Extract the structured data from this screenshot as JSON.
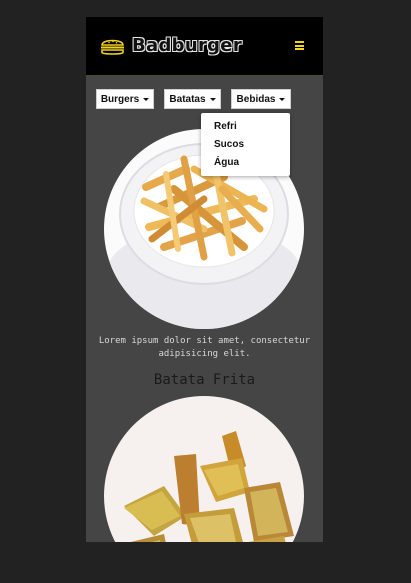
{
  "app": {
    "brand": "Badburger",
    "icons": {
      "logo": "burger-icon",
      "menu": "hamburger-menu-icon"
    },
    "accent_color": "#f2d21a"
  },
  "nav": {
    "dropdowns": [
      {
        "label": "Burgers"
      },
      {
        "label": "Batatas"
      },
      {
        "label": "Bebidas",
        "open": true
      }
    ],
    "open_menu_items": [
      "Refri",
      "Sucos",
      "Água"
    ]
  },
  "content": {
    "caption_line1": "Lorem ipsum dolor sit amet, consectetur",
    "caption_line2": "adipisicing elit.",
    "item_title": "Batata Frita"
  }
}
